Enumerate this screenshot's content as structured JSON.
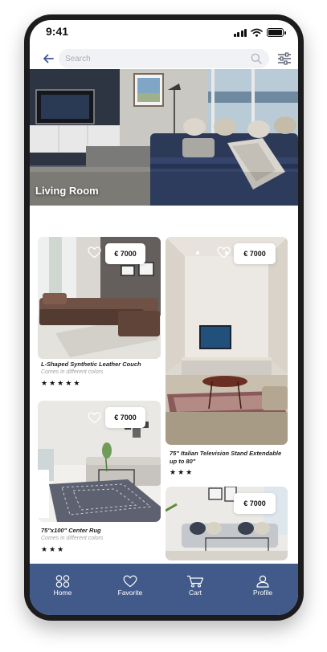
{
  "status_bar": {
    "time": "9:41"
  },
  "header": {
    "search_placeholder": "Search",
    "icons": {
      "back": "back-arrow-icon",
      "search": "search-icon",
      "filter": "filter-sliders-icon"
    }
  },
  "hero": {
    "title": "Living Room"
  },
  "products": [
    {
      "price": "€ 7000",
      "title": "L-Shaped Synthetic Leather Couch",
      "subtitle": "Comes in different colors",
      "rating": 5
    },
    {
      "price": "€ 7000",
      "title": "75\" Italian Television Stand Extendable up to 80\"",
      "subtitle": "",
      "rating": 3
    },
    {
      "price": "€ 7000",
      "title": "75\"x100\" Center Rug",
      "subtitle": "Comes in different colors",
      "rating": 3
    },
    {
      "price": "€ 7000",
      "title": "",
      "subtitle": "",
      "rating": null
    }
  ],
  "nav": {
    "items": [
      {
        "label": "Home",
        "icon": "home-grid-icon"
      },
      {
        "label": "Favorite",
        "icon": "heart-icon"
      },
      {
        "label": "Cart",
        "icon": "cart-icon"
      },
      {
        "label": "Profile",
        "icon": "profile-icon"
      }
    ]
  },
  "colors": {
    "nav_bar": "#415a89",
    "accent_blue": "#3c5a96",
    "search_bg": "#f1f2f5"
  }
}
